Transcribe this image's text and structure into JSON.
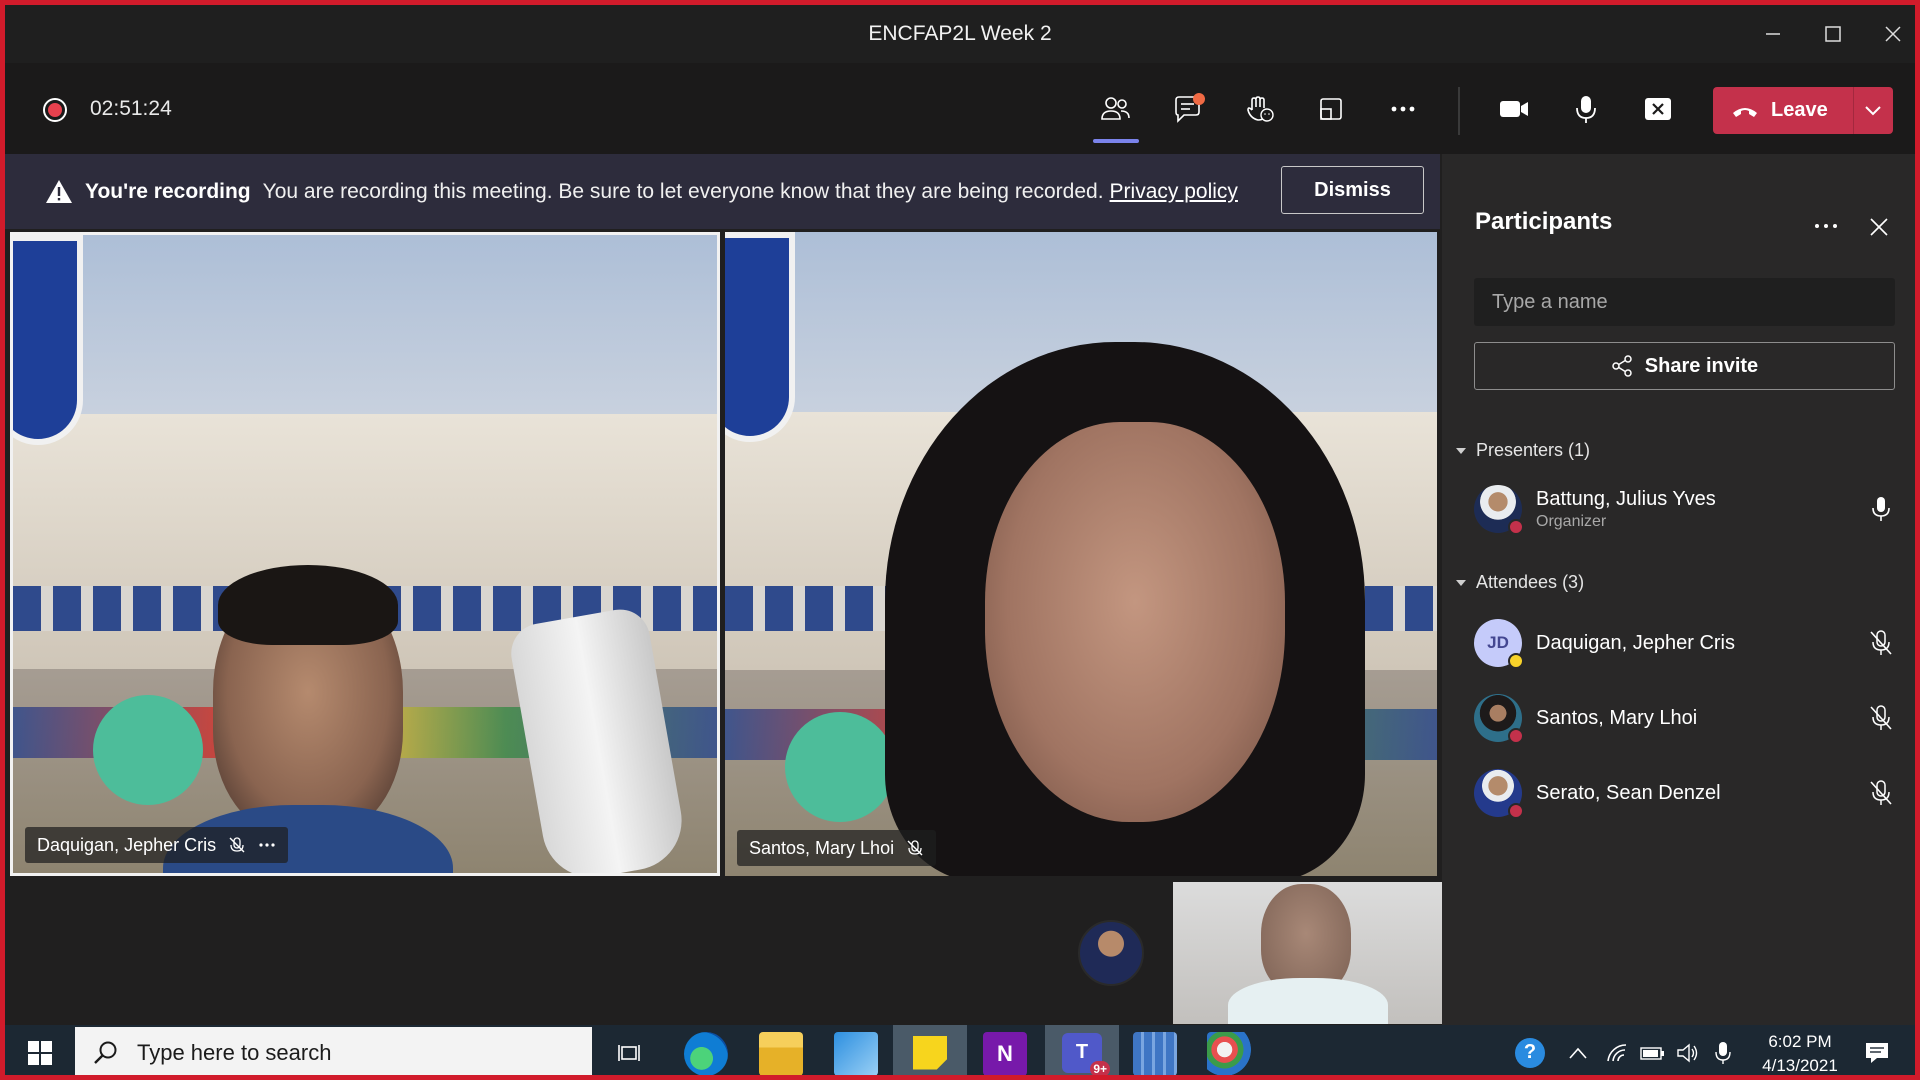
{
  "window": {
    "title": "ENCFAP2L Week 2"
  },
  "toolbar": {
    "timer": "02:51:24",
    "leave_label": "Leave",
    "icons": [
      "participants-icon",
      "chat-icon",
      "reactions-icon",
      "share-tray-icon",
      "more-icon",
      "camera-icon",
      "mic-icon",
      "share-stop-icon"
    ],
    "leave_color": "#c4314b",
    "active_indicator_color": "#7b83eb"
  },
  "banner": {
    "bold": "You're recording",
    "message": "You are recording this meeting. Be sure to let everyone know that they are being recorded.",
    "link": "Privacy policy",
    "dismiss": "Dismiss"
  },
  "videos": [
    {
      "name": "Daquigan, Jepher Cris"
    },
    {
      "name": "Santos, Mary Lhoi"
    }
  ],
  "panel": {
    "title": "Participants",
    "search_placeholder": "Type a name",
    "share_invite": "Share invite",
    "presenters_header": "Presenters (1)",
    "attendees_header": "Attendees (3)",
    "presenters": [
      {
        "name": "Battung, Julius Yves",
        "role": "Organizer"
      }
    ],
    "attendees": [
      {
        "name": "Daquigan, Jepher Cris",
        "initials": "JD"
      },
      {
        "name": "Santos, Mary Lhoi"
      },
      {
        "name": "Serato, Sean Denzel"
      }
    ]
  },
  "taskbar": {
    "search_placeholder": "Type here to search",
    "time": "6:02 PM",
    "date": "4/13/2021",
    "teams_badge": "9+"
  }
}
